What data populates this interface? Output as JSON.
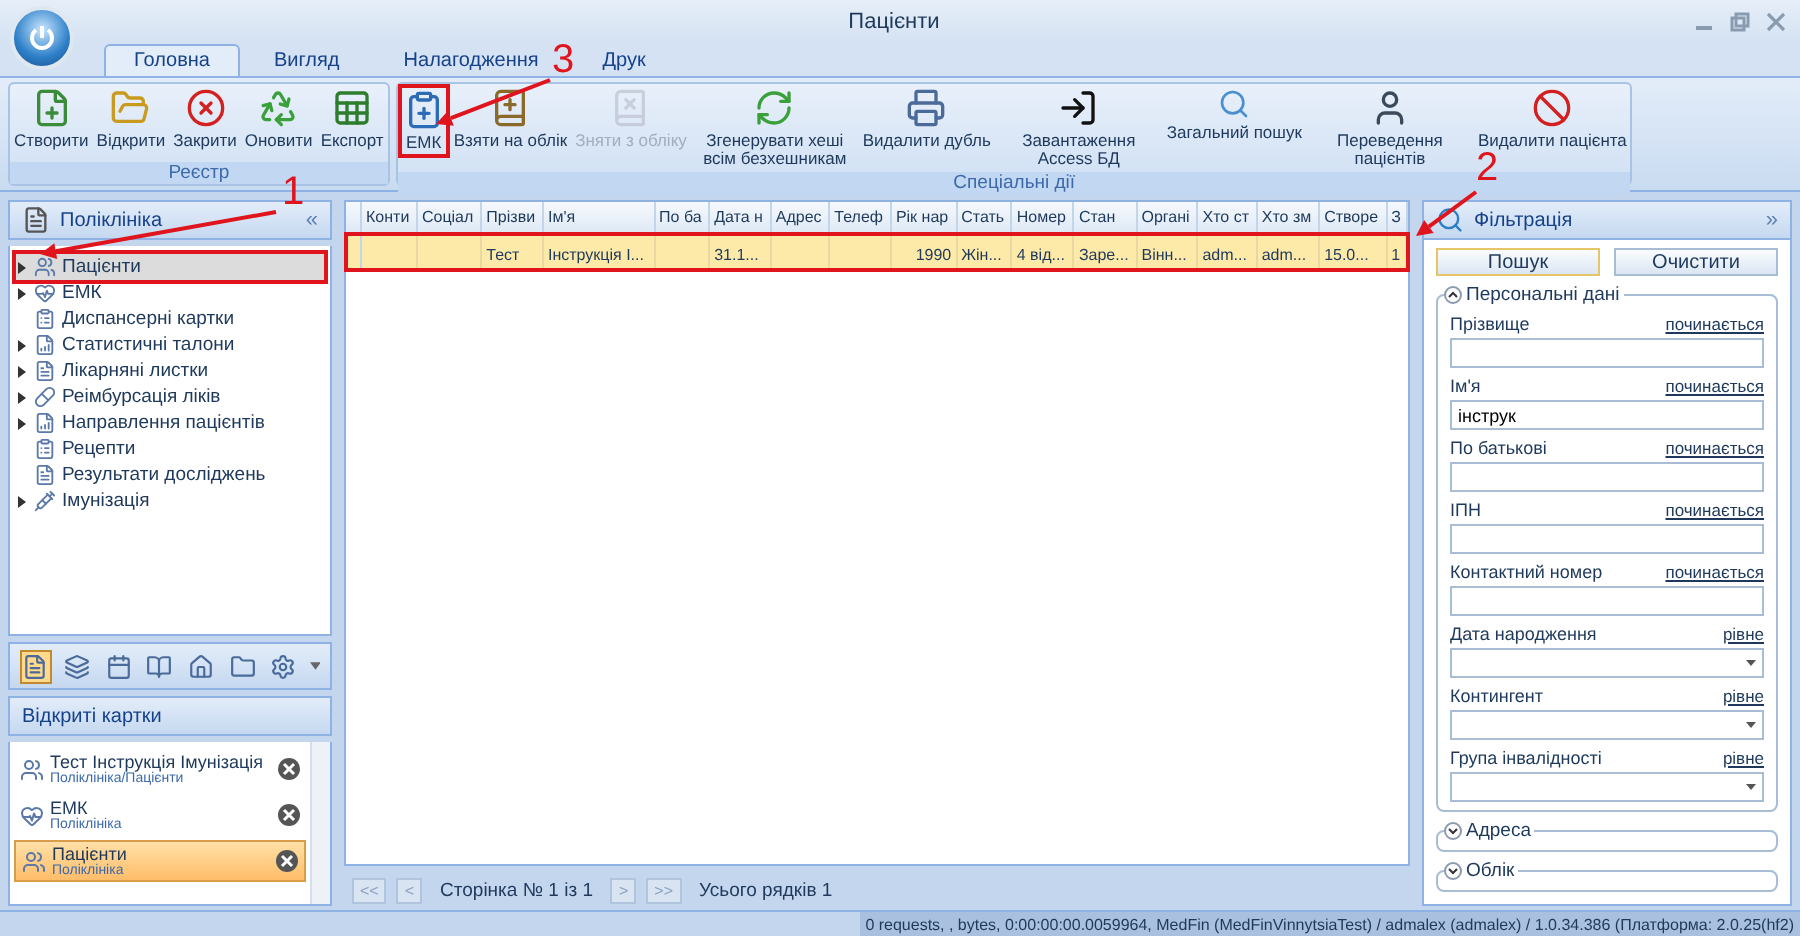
{
  "window": {
    "title": "Пацієнти"
  },
  "tabs": [
    {
      "label": "Головна",
      "selected": true
    },
    {
      "label": "Вигляд",
      "selected": false
    },
    {
      "label": "Налагодження",
      "selected": false
    },
    {
      "label": "Друк",
      "selected": false
    }
  ],
  "ribbon_groups": [
    {
      "title": "Реєстр",
      "buttons": [
        {
          "label": "Створити",
          "disabled": false,
          "highlighted": false
        },
        {
          "label": "Відкрити",
          "disabled": false,
          "highlighted": false
        },
        {
          "label": "Закрити",
          "disabled": false,
          "highlighted": false
        },
        {
          "label": "Оновити",
          "disabled": false,
          "highlighted": false
        },
        {
          "label": "Експорт",
          "disabled": false,
          "highlighted": false
        }
      ]
    },
    {
      "title": "Спеціальні дії",
      "buttons": [
        {
          "label": "ЕМК",
          "disabled": false,
          "highlighted": true
        },
        {
          "label": "Взяти на облік",
          "disabled": false,
          "highlighted": false
        },
        {
          "label": "Зняти з обліку",
          "disabled": true,
          "highlighted": false
        },
        {
          "label": "Згенерувати хеші всім безхешникам",
          "disabled": false,
          "highlighted": false
        },
        {
          "label": "Видалити дубль",
          "disabled": false,
          "highlighted": false
        },
        {
          "label": "Завантаження Access БД",
          "disabled": false,
          "highlighted": false
        },
        {
          "label": "Загальний пошук",
          "disabled": false,
          "highlighted": false
        },
        {
          "label": "Переведення пацієнтів",
          "disabled": false,
          "highlighted": false
        },
        {
          "label": "Видалити пацієнта",
          "disabled": false,
          "highlighted": false
        }
      ]
    }
  ],
  "navigator": {
    "title": "Поліклініка",
    "collapse": "«",
    "items": [
      {
        "label": "Пацієнти",
        "expandable": true,
        "selected": true,
        "highlighted": true
      },
      {
        "label": "ЕМК",
        "expandable": true,
        "selected": false,
        "highlighted": false
      },
      {
        "label": "Диспансерні картки",
        "expandable": false,
        "selected": false,
        "highlighted": false
      },
      {
        "label": "Статистичні талони",
        "expandable": true,
        "selected": false,
        "highlighted": false
      },
      {
        "label": "Лікарняні листки",
        "expandable": true,
        "selected": false,
        "highlighted": false
      },
      {
        "label": "Реімбурсація ліків",
        "expandable": true,
        "selected": false,
        "highlighted": false
      },
      {
        "label": "Направлення пацієнтів",
        "expandable": true,
        "selected": false,
        "highlighted": false
      },
      {
        "label": "Рецепти",
        "expandable": false,
        "selected": false,
        "highlighted": false
      },
      {
        "label": "Результати досліджень",
        "expandable": false,
        "selected": false,
        "highlighted": false
      },
      {
        "label": "Імунізація",
        "expandable": true,
        "selected": false,
        "highlighted": false
      }
    ],
    "modules": [
      {
        "selected": true
      },
      {
        "selected": false
      },
      {
        "selected": false
      },
      {
        "selected": false
      },
      {
        "selected": false
      },
      {
        "selected": false
      },
      {
        "selected": false
      }
    ]
  },
  "open_cards": {
    "title": "Відкриті картки",
    "items": [
      {
        "title": "Тест Інструкція Імунізація",
        "path": "Поліклініка/Пацієнти",
        "selected": false
      },
      {
        "title": "ЕМК",
        "path": "Поліклініка",
        "selected": false
      },
      {
        "title": "Пацієнти",
        "path": "Поліклініка",
        "selected": true
      }
    ]
  },
  "table": {
    "columns": [
      "Конти",
      "Соціал",
      "Прізви",
      "Ім'я",
      "По ба",
      "Дата н",
      "Адрес",
      "Телеф",
      "Рік нар",
      "Стать",
      "Номер",
      "Стан",
      "Органі",
      "Хто ст",
      "Хто зм",
      "Створе",
      "З"
    ],
    "rows": [
      {
        "selected": true,
        "highlighted": true,
        "cells": [
          "",
          "",
          "Тест",
          "Інструкція І...",
          "",
          "31.1...",
          "",
          "",
          "1990",
          "Жін...",
          "4 від...",
          "Заре...",
          "Вінн...",
          "adm...",
          "adm...",
          "15.0...",
          "1"
        ]
      }
    ]
  },
  "pager": {
    "first": "<<",
    "prev": "<",
    "page": "Сторінка № 1 із 1",
    "next": ">",
    "last": ">>",
    "total": "Усього рядків 1"
  },
  "filter": {
    "title": "Фільтрація",
    "expand": "»",
    "search": "Пошук",
    "clear": "Очистити",
    "sections": [
      {
        "title": "Персональні дані",
        "expanded": true,
        "fields": [
          {
            "label": "Прізвище",
            "mode": "починається",
            "kind": "text"
          },
          {
            "label": "Ім'я",
            "mode": "починається",
            "kind": "text",
            "value": "інструк"
          },
          {
            "label": "По батькові",
            "mode": "починається",
            "kind": "text"
          },
          {
            "label": "ІПН",
            "mode": "починається",
            "kind": "text"
          },
          {
            "label": "Контактний номер",
            "mode": "починається",
            "kind": "text"
          },
          {
            "label": "Дата народження",
            "mode": "рівне",
            "kind": "select"
          },
          {
            "label": "Контингент",
            "mode": "рівне",
            "kind": "select"
          },
          {
            "label": "Група інвалідності",
            "mode": "рівне",
            "kind": "select"
          }
        ]
      },
      {
        "title": "Адреса",
        "expanded": false
      },
      {
        "title": "Облік",
        "expanded": false
      }
    ]
  },
  "status_bar": "0 requests, , bytes, 0:00:00:00.0059964, MedFin (MedFinVinnytsiaTest) / admalex (admalex) / 1.0.34.386 (Платформа: 2.0.25(hf2)",
  "annotations": [
    {
      "label": "1"
    },
    {
      "label": "2"
    },
    {
      "label": "3"
    }
  ]
}
